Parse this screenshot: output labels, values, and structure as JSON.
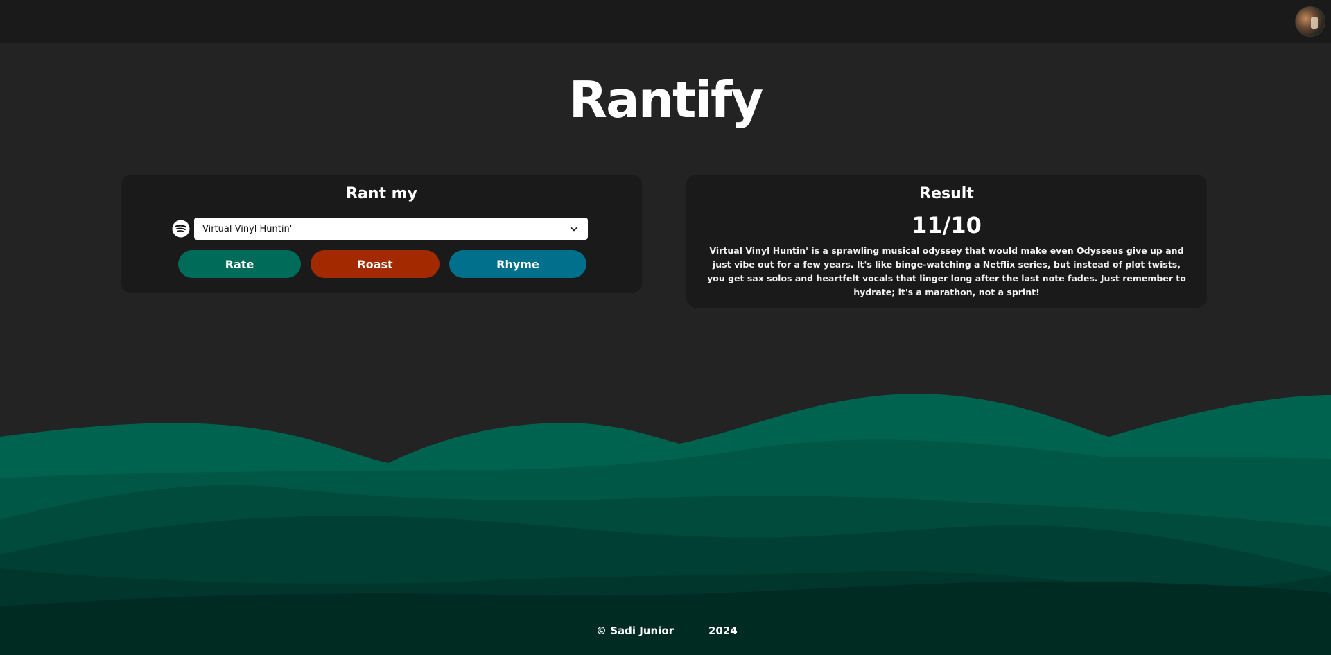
{
  "app": {
    "title": "Rantify"
  },
  "rant_card": {
    "title": "Rant my",
    "select_value": "Virtual Vinyl Huntin'",
    "buttons": {
      "rate": "Rate",
      "roast": "Roast",
      "rhyme": "Rhyme"
    }
  },
  "result_card": {
    "title": "Result",
    "score": "11/10",
    "text": "Virtual Vinyl Huntin' is a sprawling musical odyssey that would make even Odysseus give up and just vibe out for a few years. It's like binge-watching a Netflix series, but instead of plot twists, you get sax solos and heartfelt vocals that linger long after the last note fades. Just remember to hydrate; it's a marathon, not a sprint!"
  },
  "footer": {
    "copyright": "© Sadi Junior",
    "year": "2024"
  },
  "icons": {
    "service": "spotify-icon",
    "dropdown": "chevron-down-icon",
    "profile": "avatar"
  },
  "colors": {
    "background": "#232323",
    "panel": "#1a1a1a",
    "rate": "#006b58",
    "roast": "#a32a00",
    "rhyme": "#00708c",
    "wave_light": "#00634f",
    "wave_dark": "#002a22"
  }
}
